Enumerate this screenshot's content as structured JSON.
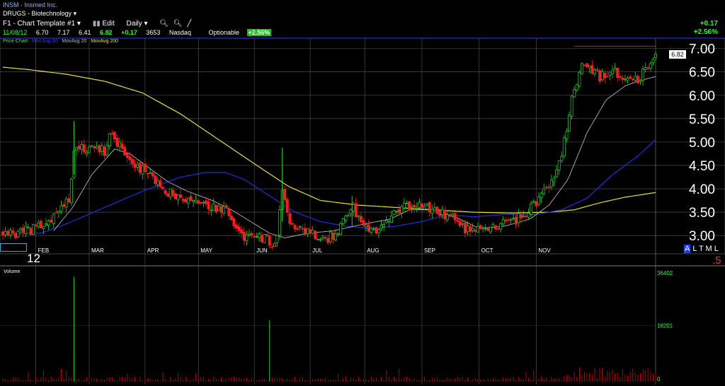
{
  "header": {
    "symbol_title": "INSM - Insmed Inc.",
    "group": "DRUGS - Biotechnology",
    "template_label": "F1 - Chart Template #1",
    "edit_label": "Edit",
    "period_label": "Daily",
    "quote": {
      "date": "11/08/12",
      "open": "6.70",
      "high": "7.17",
      "low": "6.41",
      "close": "6.82",
      "change": "+0.17",
      "volume": "3653",
      "exchange": "Nasdaq",
      "optionable": "Optionable",
      "pct_change": "+2.56%"
    },
    "change_top": "+0.17",
    "pct_top": "+2.56%"
  },
  "legend": {
    "price_chart": "Price Chart",
    "mov_avg_50": "Mov Avg 50",
    "mov_avg_20": "MovAvg 20",
    "mov_avg_200": "MovAvg 200"
  },
  "volume_label": "Volume",
  "last_price_tag": "6.82",
  "scale_options": {
    "a": "A",
    "rest": "L T M L"
  },
  "half_marker": ".5",
  "year_label": "12",
  "colors": {
    "up": "#2bd22b",
    "down": "#ff1a1a",
    "ma20": "#b4b4b4",
    "ma50": "#1c2ee8",
    "ma200": "#e8e02a",
    "grid": "#5a5a5a",
    "volume": "#c00000",
    "volume_spike": "#22c222"
  },
  "chart_data": {
    "type": "line",
    "title": "INSM - Insmed Inc.",
    "price_axis": {
      "ticks": [
        "3.00",
        "3.50",
        "4.00",
        "4.50",
        "5.00",
        "5.50",
        "6.00",
        "6.50",
        "7.00"
      ],
      "ylim": [
        2.7,
        7.1
      ]
    },
    "volume_axis": {
      "ticks": [
        "36402",
        "18201",
        "0"
      ],
      "ylim": [
        0,
        36402
      ]
    },
    "x_tick_labels": [
      "FEB",
      "MAR",
      "APR",
      "MAY",
      "JUN",
      "JUL",
      "AUG",
      "SEP",
      "OCT",
      "NOV"
    ],
    "price_anchors": [
      [
        0,
        3.08
      ],
      [
        8,
        3.05
      ],
      [
        20,
        3.1
      ],
      [
        35,
        3.25
      ],
      [
        45,
        3.55
      ],
      [
        52,
        3.75
      ],
      [
        56,
        4.85
      ],
      [
        62,
        4.85
      ],
      [
        70,
        4.9
      ],
      [
        80,
        4.8
      ],
      [
        85,
        5.2
      ],
      [
        92,
        4.9
      ],
      [
        100,
        4.6
      ],
      [
        110,
        4.4
      ],
      [
        120,
        4.15
      ],
      [
        125,
        3.95
      ],
      [
        135,
        3.9
      ],
      [
        145,
        3.8
      ],
      [
        155,
        3.75
      ],
      [
        165,
        3.6
      ],
      [
        175,
        3.55
      ],
      [
        180,
        3.4
      ],
      [
        185,
        3.05
      ],
      [
        195,
        2.95
      ],
      [
        205,
        2.95
      ],
      [
        215,
        2.8
      ],
      [
        220,
        3.9
      ],
      [
        225,
        3.3
      ],
      [
        235,
        3.1
      ],
      [
        245,
        3.0
      ],
      [
        255,
        2.95
      ],
      [
        262,
        3.0
      ],
      [
        268,
        3.35
      ],
      [
        275,
        3.65
      ],
      [
        280,
        3.4
      ],
      [
        285,
        3.15
      ],
      [
        295,
        3.1
      ],
      [
        305,
        3.35
      ],
      [
        312,
        3.55
      ],
      [
        320,
        3.65
      ],
      [
        330,
        3.65
      ],
      [
        340,
        3.55
      ],
      [
        345,
        3.45
      ],
      [
        355,
        3.4
      ],
      [
        362,
        3.2
      ],
      [
        368,
        3.05
      ],
      [
        375,
        3.1
      ],
      [
        385,
        3.15
      ],
      [
        395,
        3.25
      ],
      [
        405,
        3.35
      ],
      [
        415,
        3.55
      ],
      [
        425,
        3.9
      ],
      [
        430,
        4.0
      ],
      [
        435,
        4.3
      ],
      [
        440,
        4.7
      ],
      [
        444,
        5.3
      ],
      [
        448,
        5.9
      ],
      [
        452,
        6.3
      ],
      [
        456,
        6.7
      ],
      [
        462,
        6.6
      ],
      [
        470,
        6.4
      ],
      [
        480,
        6.5
      ],
      [
        490,
        6.4
      ],
      [
        495,
        6.45
      ],
      [
        500,
        6.3
      ],
      [
        506,
        6.55
      ],
      [
        510,
        6.6
      ],
      [
        514,
        6.82
      ]
    ],
    "ma20_anchors": [
      [
        40,
        3.1
      ],
      [
        55,
        3.6
      ],
      [
        70,
        4.3
      ],
      [
        88,
        4.85
      ],
      [
        100,
        4.75
      ],
      [
        115,
        4.45
      ],
      [
        130,
        4.15
      ],
      [
        145,
        3.95
      ],
      [
        165,
        3.75
      ],
      [
        180,
        3.55
      ],
      [
        195,
        3.3
      ],
      [
        210,
        3.05
      ],
      [
        222,
        2.95
      ],
      [
        240,
        3.05
      ],
      [
        260,
        3.1
      ],
      [
        285,
        3.25
      ],
      [
        305,
        3.35
      ],
      [
        320,
        3.55
      ],
      [
        340,
        3.55
      ],
      [
        360,
        3.35
      ],
      [
        375,
        3.15
      ],
      [
        395,
        3.2
      ],
      [
        415,
        3.35
      ],
      [
        430,
        3.65
      ],
      [
        445,
        4.2
      ],
      [
        460,
        5.2
      ],
      [
        475,
        5.9
      ],
      [
        490,
        6.2
      ],
      [
        500,
        6.3
      ],
      [
        514,
        6.4
      ]
    ],
    "ma50_anchors": [
      [
        0,
        3.05
      ],
      [
        30,
        3.05
      ],
      [
        50,
        3.25
      ],
      [
        80,
        3.6
      ],
      [
        110,
        3.95
      ],
      [
        140,
        4.25
      ],
      [
        160,
        4.35
      ],
      [
        175,
        4.35
      ],
      [
        190,
        4.2
      ],
      [
        210,
        3.85
      ],
      [
        230,
        3.5
      ],
      [
        250,
        3.3
      ],
      [
        270,
        3.2
      ],
      [
        290,
        3.15
      ],
      [
        310,
        3.2
      ],
      [
        330,
        3.3
      ],
      [
        350,
        3.45
      ],
      [
        370,
        3.4
      ],
      [
        395,
        3.45
      ],
      [
        420,
        3.45
      ],
      [
        440,
        3.55
      ],
      [
        460,
        3.8
      ],
      [
        480,
        4.3
      ],
      [
        500,
        4.7
      ],
      [
        514,
        5.05
      ]
    ],
    "ma200_anchors": [
      [
        0,
        6.6
      ],
      [
        20,
        6.55
      ],
      [
        50,
        6.45
      ],
      [
        80,
        6.3
      ],
      [
        110,
        6.05
      ],
      [
        140,
        5.6
      ],
      [
        170,
        5.05
      ],
      [
        200,
        4.5
      ],
      [
        225,
        4.05
      ],
      [
        250,
        3.75
      ],
      [
        280,
        3.65
      ],
      [
        310,
        3.6
      ],
      [
        340,
        3.55
      ],
      [
        370,
        3.5
      ],
      [
        400,
        3.48
      ],
      [
        430,
        3.5
      ],
      [
        450,
        3.55
      ],
      [
        470,
        3.7
      ],
      [
        490,
        3.82
      ],
      [
        514,
        3.92
      ]
    ],
    "volume_spikes": [
      [
        45,
        36402
      ],
      [
        56,
        34000
      ],
      [
        210,
        20000
      ],
      [
        295,
        28500
      ]
    ]
  }
}
